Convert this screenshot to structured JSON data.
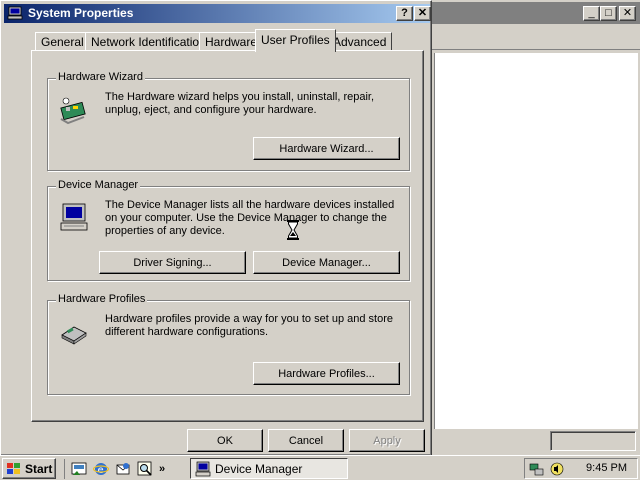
{
  "dialog": {
    "title": "System Properties",
    "help_label": "?",
    "close_label": "✕"
  },
  "tabs": [
    {
      "label": "General"
    },
    {
      "label": "Network Identification"
    },
    {
      "label": "Hardware"
    },
    {
      "label": "User Profiles"
    },
    {
      "label": "Advanced"
    }
  ],
  "groups": {
    "wizard": {
      "title": "Hardware Wizard",
      "description": "The Hardware wizard helps you install, uninstall, repair, unplug, eject, and configure your hardware.",
      "button": "Hardware Wizard..."
    },
    "device_manager": {
      "title": "Device Manager",
      "description": "The Device Manager lists all the hardware devices installed on your computer. Use the Device Manager to change the properties of any device.",
      "button_signing": "Driver Signing...",
      "button_dm": "Device Manager..."
    },
    "profiles": {
      "title": "Hardware Profiles",
      "description": "Hardware profiles provide a way for you to set up and store different hardware configurations.",
      "button": "Hardware Profiles..."
    }
  },
  "buttons": {
    "ok": "OK",
    "cancel": "Cancel",
    "apply": "Apply"
  },
  "background": {
    "minimize": "_",
    "maximize": "□",
    "close": "✕",
    "tree_toggle": "−"
  },
  "taskbar": {
    "start": "Start",
    "ql_more": "»",
    "task_label": "Device Manager",
    "clock": "9:45 PM"
  }
}
